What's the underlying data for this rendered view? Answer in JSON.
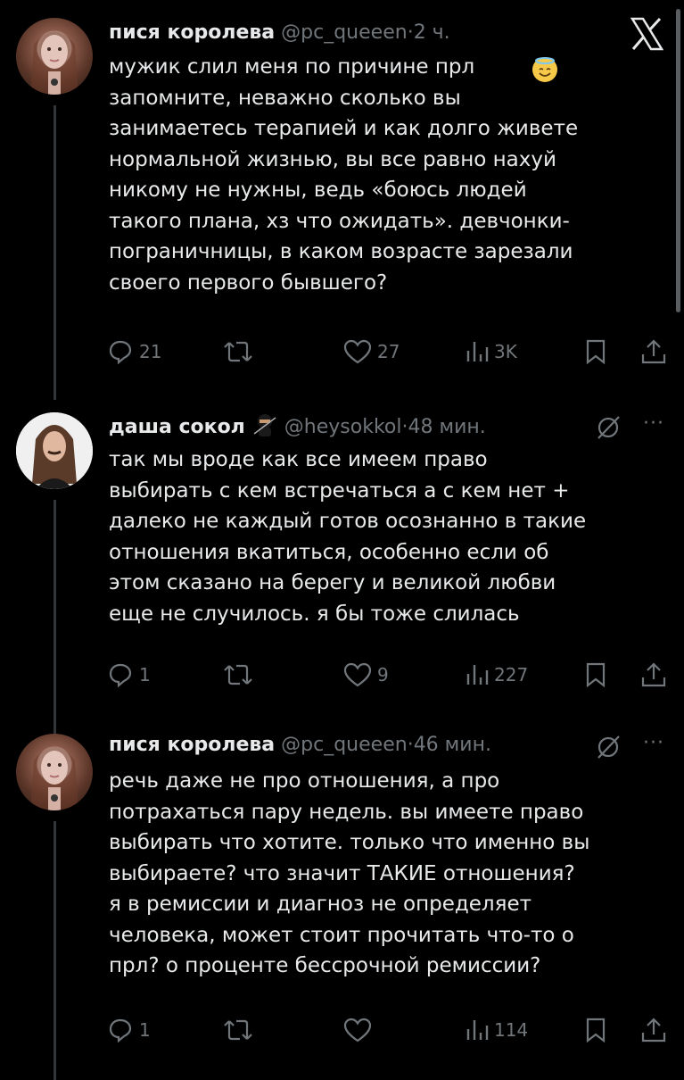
{
  "tweets": [
    {
      "name": "пися королева",
      "badge": "",
      "handle": "@pc_queeen",
      "sep": "·",
      "time": "2 ч.",
      "text": "мужик слил меня по причине прл \nзапомните, неважно сколько вы\nзанимаетесь терапией и как долго живете\nнормальной жизнью, вы все равно нахуй\nникому не нужны, ведь «боюсь людей\nтакого плана, хз что ожидать». девчонки-\nпограничницы, в каком возрасте зарезали\nсвоего первого бывшего?",
      "emoji_icon": "smiling-face-with-halo-icon",
      "replies": "21",
      "retweets": "",
      "likes": "27",
      "views": "3K"
    },
    {
      "name": "даша сокол",
      "badge": "ninja-icon",
      "handle": "@heysokkol",
      "sep": "·",
      "time": "48 мин.",
      "text": "так мы вроде как все имеем право\nвыбирать с кем встречаться а с кем нет +\nдалеко не каждый готов осознанно в такие\nотношения вкатиться, особенно если об\nэтом сказано на берегу и великой любви\nеще не случилось. я бы тоже слилась",
      "replies": "1",
      "retweets": "",
      "likes": "9",
      "views": "227"
    },
    {
      "name": "пися королева",
      "badge": "",
      "handle": "@pc_queeen",
      "sep": "·",
      "time": "46 мин.",
      "text": "речь даже не про отношения, а про\nпотрахаться пару недель. вы имеете право\nвыбирать что хотите. только что именно вы\nвыбираете? что значит ТАКИЕ отношения?\nя в ремиссии и диагноз не определяет\nчеловека, может стоит прочитать что-то о\nпрл? о проценте бессрочной ремиссии?",
      "replies": "1",
      "retweets": "",
      "likes": "",
      "views": "114"
    }
  ],
  "ui": {
    "more_label": "···",
    "close_icon": "x-logo-icon",
    "grok_icon": "grok-icon"
  }
}
